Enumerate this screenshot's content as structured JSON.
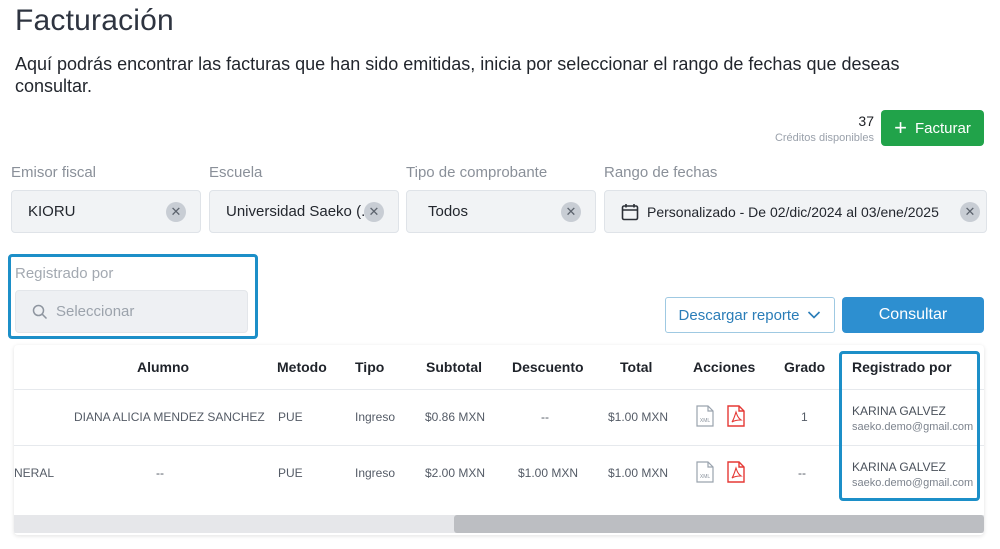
{
  "page": {
    "title": "Facturación",
    "intro": "Aquí podrás encontrar las facturas que han sido emitidas, inicia por seleccionar el rango de fechas que deseas consultar."
  },
  "credits": {
    "count": "37",
    "label": "Créditos disponibles"
  },
  "buttons": {
    "facturar": "Facturar",
    "descargar": "Descargar reporte",
    "consultar": "Consultar"
  },
  "filters": {
    "emisor": {
      "label": "Emisor fiscal",
      "value": "KIORU"
    },
    "escuela": {
      "label": "Escuela",
      "value": "Universidad Saeko (..."
    },
    "tipo": {
      "label": "Tipo de comprobante",
      "value": "Todos"
    },
    "rango": {
      "label": "Rango de fechas",
      "value": "Personalizado - De 02/dic/2024 al 03/ene/2025"
    },
    "registrado": {
      "label": "Registrado por",
      "placeholder": "Seleccionar"
    }
  },
  "table": {
    "headers": {
      "alumno": "Alumno",
      "metodo": "Metodo",
      "tipo": "Tipo",
      "subtotal": "Subtotal",
      "descuento": "Descuento",
      "total": "Total",
      "acciones": "Acciones",
      "grado": "Grado",
      "registrado": "Registrado por"
    },
    "rows": [
      {
        "leading": "",
        "alumno": "DIANA ALICIA MENDEZ SANCHEZ",
        "metodo": "PUE",
        "tipo": "Ingreso",
        "subtotal": "$0.86 MXN",
        "descuento": "--",
        "total": "$1.00 MXN",
        "grado": "1",
        "registrado_nombre": "KARINA GALVEZ",
        "registrado_email": "saeko.demo@gmail.com"
      },
      {
        "leading": "NERAL",
        "alumno": "--",
        "metodo": "PUE",
        "tipo": "Ingreso",
        "subtotal": "$2.00 MXN",
        "descuento": "$1.00 MXN",
        "total": "$1.00 MXN",
        "grado": "--",
        "registrado_nombre": "KARINA GALVEZ",
        "registrado_email": "saeko.demo@gmail.com"
      }
    ],
    "xml_label": "XML"
  },
  "colors": {
    "primary": "#2d8fd0",
    "success": "#21a34a",
    "highlight": "#1c8fc8",
    "pdf": "#e53935"
  }
}
